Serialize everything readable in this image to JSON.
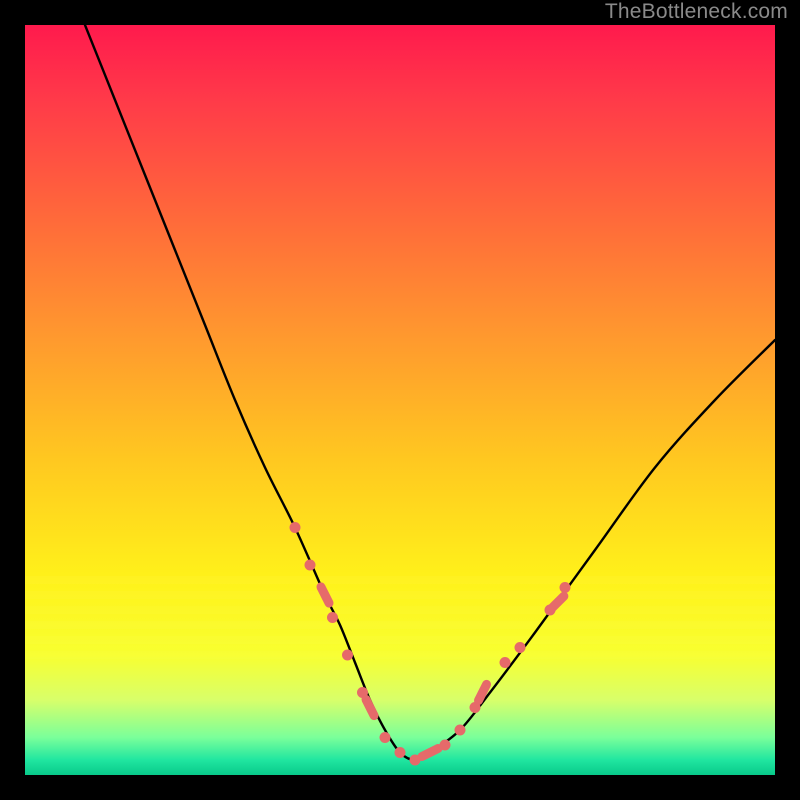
{
  "watermark": {
    "text": "TheBottleneck.com"
  },
  "chart_data": {
    "type": "line",
    "title": "",
    "xlabel": "",
    "ylabel": "",
    "xlim": [
      0,
      100
    ],
    "ylim": [
      0,
      100
    ],
    "grid": false,
    "legend": false,
    "series": [
      {
        "name": "bottleneck-curve",
        "x": [
          8,
          12,
          16,
          20,
          24,
          28,
          32,
          36,
          40,
          42,
          44,
          46,
          48,
          50,
          52,
          54,
          58,
          62,
          68,
          76,
          84,
          92,
          100
        ],
        "y": [
          100,
          90,
          80,
          70,
          60,
          50,
          41,
          33,
          24,
          20,
          15,
          10,
          6,
          3,
          2,
          3,
          6,
          11,
          19,
          30,
          41,
          50,
          58
        ],
        "color": "#000000"
      },
      {
        "name": "highlight-dots",
        "type": "scatter",
        "color": "#e66a6a",
        "points": [
          {
            "x": 36,
            "y": 33
          },
          {
            "x": 38,
            "y": 28
          },
          {
            "x": 40,
            "y": 24
          },
          {
            "x": 41,
            "y": 21
          },
          {
            "x": 43,
            "y": 16
          },
          {
            "x": 45,
            "y": 11
          },
          {
            "x": 46,
            "y": 9
          },
          {
            "x": 48,
            "y": 5
          },
          {
            "x": 50,
            "y": 3
          },
          {
            "x": 52,
            "y": 2
          },
          {
            "x": 54,
            "y": 3
          },
          {
            "x": 56,
            "y": 4
          },
          {
            "x": 58,
            "y": 6
          },
          {
            "x": 60,
            "y": 9
          },
          {
            "x": 61,
            "y": 11
          },
          {
            "x": 64,
            "y": 15
          },
          {
            "x": 66,
            "y": 17
          },
          {
            "x": 70,
            "y": 22
          },
          {
            "x": 71,
            "y": 23
          },
          {
            "x": 72,
            "y": 25
          }
        ]
      }
    ],
    "background_layers": {
      "gradient": "vertical red→orange→yellow→green",
      "horizontal_white_bands_y": [
        16,
        18,
        20,
        22,
        24,
        26
      ]
    }
  }
}
